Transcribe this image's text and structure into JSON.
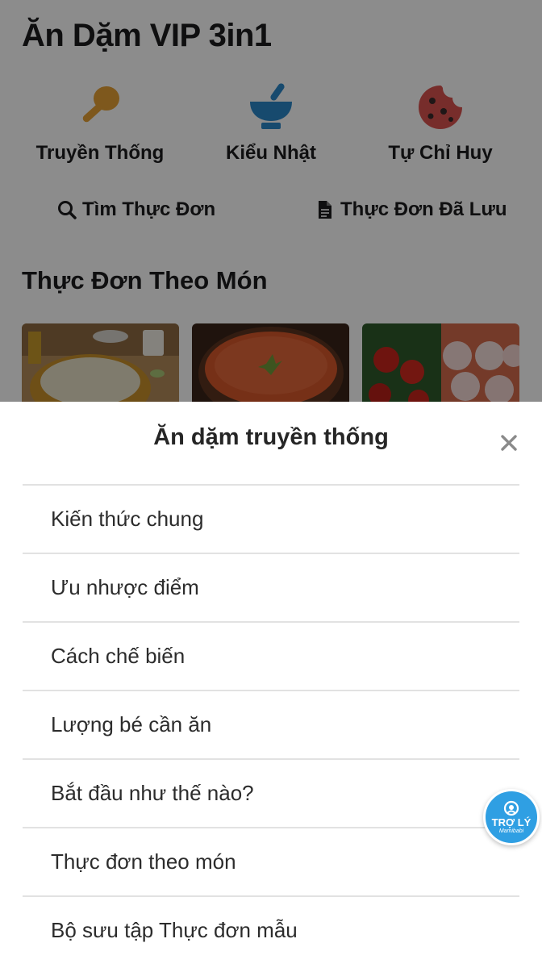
{
  "app": {
    "title": "Ăn Dặm VIP 3in1"
  },
  "categories": [
    {
      "label": "Truyền Thống",
      "icon": "spoon-icon",
      "color": "#e5a035"
    },
    {
      "label": "Kiểu Nhật",
      "icon": "mortar-bowl-icon",
      "color": "#2b87c9"
    },
    {
      "label": "Tự Chỉ Huy",
      "icon": "cookie-icon",
      "color": "#d9534f"
    }
  ],
  "quick_links": [
    {
      "label": "Tìm Thực Đơn",
      "icon": "search-icon"
    },
    {
      "label": "Thực Đơn Đã Lưu",
      "icon": "document-icon"
    }
  ],
  "section": {
    "title": "Thực Đơn Theo Món"
  },
  "thumbnails": [
    {
      "icon": "porridge-photo-icon"
    },
    {
      "icon": "soup-photo-icon"
    },
    {
      "icon": "tomato-photo-icon"
    }
  ],
  "sheet": {
    "title": "Ăn dặm truyền thống",
    "close_icon": "close-icon",
    "items": [
      {
        "label": "Kiến thức chung"
      },
      {
        "label": "Ưu nhược điểm"
      },
      {
        "label": "Cách chế biến"
      },
      {
        "label": "Lượng bé cần ăn"
      },
      {
        "label": "Bắt đầu như thế nào?"
      },
      {
        "label": "Thực đơn theo món"
      },
      {
        "label": "Bộ sưu tập Thực đơn mẫu"
      }
    ]
  },
  "assistant": {
    "label": "TRỢ LÝ",
    "brand": "Mamibabi",
    "icon": "assistant-icon",
    "color": "#2f9fe3"
  },
  "colors": {
    "scrim": "rgba(0,0,0,0.45)",
    "divider": "#e2e2e2",
    "text": "#2c2c2c"
  }
}
